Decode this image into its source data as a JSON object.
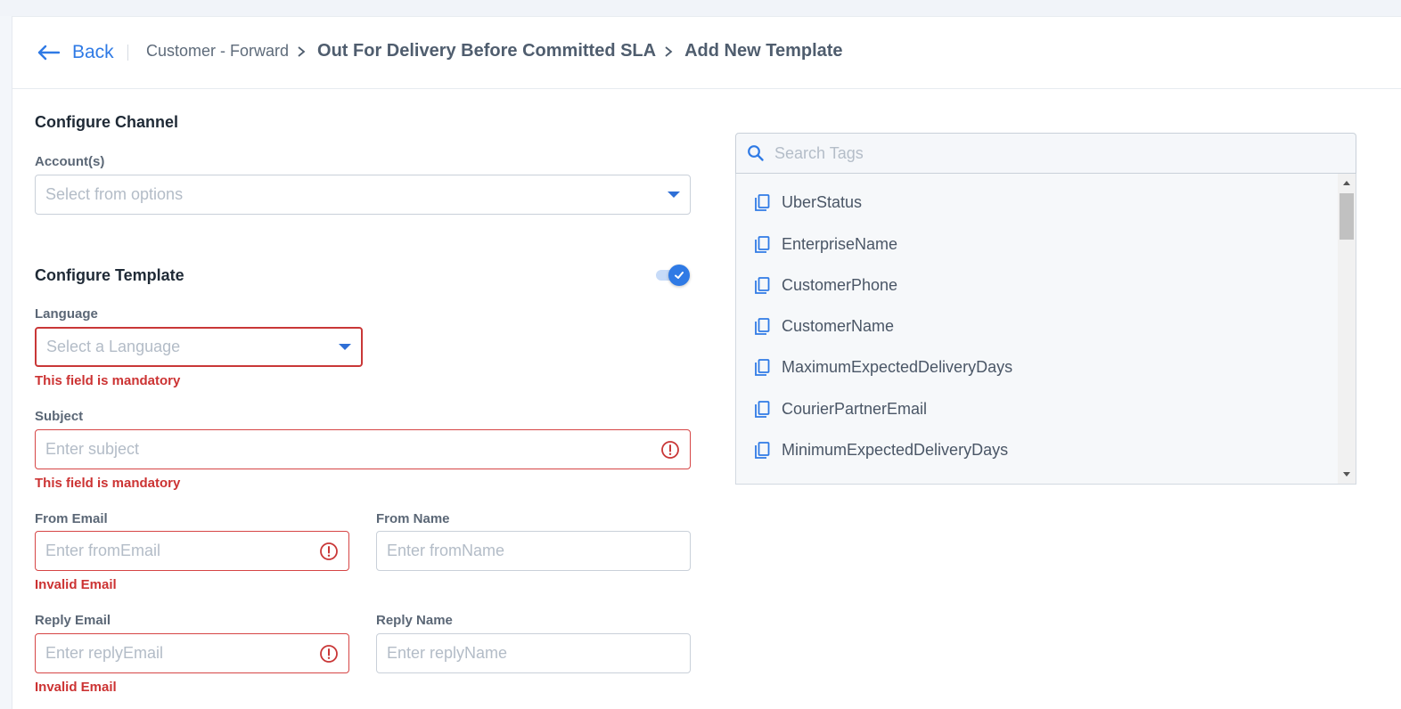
{
  "header": {
    "back_label": "Back",
    "breadcrumbs": [
      "Customer - Forward",
      "Out For Delivery Before Committed SLA",
      "Add New Template"
    ]
  },
  "channel": {
    "title": "Configure Channel",
    "accounts_label": "Account(s)",
    "accounts_placeholder": "Select from options"
  },
  "template": {
    "title": "Configure Template",
    "toggle_on": true,
    "language_label": "Language",
    "language_placeholder": "Select a Language",
    "language_error": "This field is mandatory",
    "subject_label": "Subject",
    "subject_placeholder": "Enter subject",
    "subject_error": "This field is mandatory",
    "from_email_label": "From Email",
    "from_email_placeholder": "Enter fromEmail",
    "from_email_error": "Invalid Email",
    "from_name_label": "From Name",
    "from_name_placeholder": "Enter fromName",
    "reply_email_label": "Reply Email",
    "reply_email_placeholder": "Enter replyEmail",
    "reply_email_error": "Invalid Email",
    "reply_name_label": "Reply Name",
    "reply_name_placeholder": "Enter replyName"
  },
  "tags": {
    "search_placeholder": "Search Tags",
    "items": [
      "UberStatus",
      "EnterpriseName",
      "CustomerPhone",
      "CustomerName",
      "MaximumExpectedDeliveryDays",
      "CourierPartnerEmail",
      "MinimumExpectedDeliveryDays"
    ]
  },
  "colors": {
    "accent": "#2f7ae5",
    "error": "#cc3333"
  }
}
